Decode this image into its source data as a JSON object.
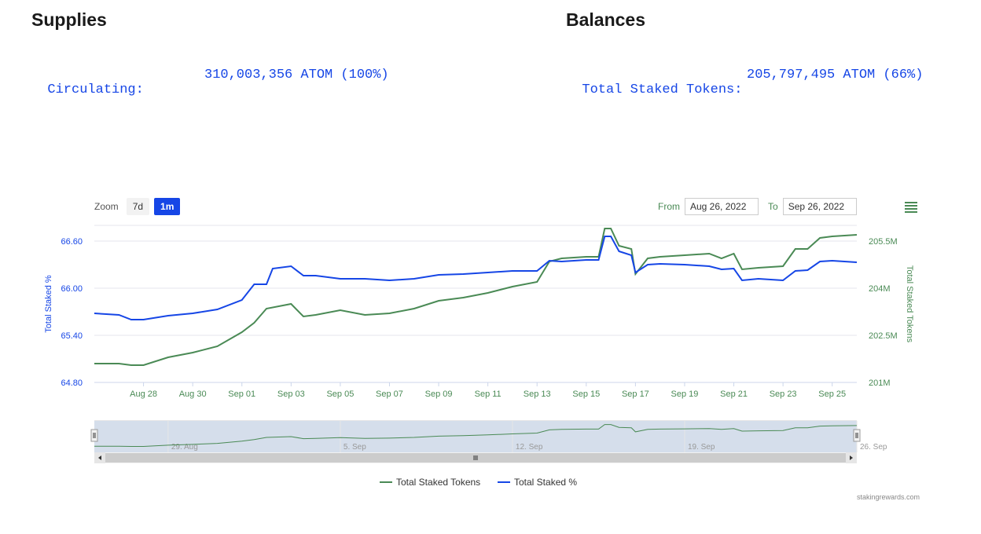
{
  "supplies": {
    "title": "Supplies",
    "label": "Circulating:",
    "value": "310,003,356 ATOM (100%)"
  },
  "balances": {
    "title": "Balances",
    "label": "Total Staked Tokens:",
    "value": "205,797,495 ATOM (66%)"
  },
  "toolbar": {
    "zoom_label": "Zoom",
    "zoom_buttons": [
      "7d",
      "1m"
    ],
    "zoom_active": "1m",
    "from_label": "From",
    "from_value": "Aug 26, 2022",
    "to_label": "To",
    "to_value": "Sep 26, 2022",
    "menu_icon": "hamburger-menu-icon"
  },
  "credit": "stakingrewards.com",
  "colors": {
    "tokens": "#4a8a55",
    "percent": "#1646e6",
    "navigator_fill": "#d5deeb",
    "grid": "#e4e4ee"
  },
  "chart_data": {
    "type": "line",
    "x_range": [
      "2022-08-26",
      "2022-09-26"
    ],
    "x_ticks": [
      "Aug 28",
      "Aug 30",
      "Sep 01",
      "Sep 03",
      "Sep 05",
      "Sep 07",
      "Sep 09",
      "Sep 11",
      "Sep 13",
      "Sep 15",
      "Sep 17",
      "Sep 19",
      "Sep 21",
      "Sep 23",
      "Sep 25"
    ],
    "x_tick_dates": [
      "2022-08-28",
      "2022-08-30",
      "2022-09-01",
      "2022-09-03",
      "2022-09-05",
      "2022-09-07",
      "2022-09-09",
      "2022-09-11",
      "2022-09-13",
      "2022-09-15",
      "2022-09-17",
      "2022-09-19",
      "2022-09-21",
      "2022-09-23",
      "2022-09-25"
    ],
    "y_left": {
      "label": "Total Staked %",
      "ticks": [
        "64.80",
        "65.40",
        "66.00",
        "66.60"
      ],
      "range": [
        64.8,
        66.8
      ]
    },
    "y_right": {
      "label": "Total Staked Tokens",
      "ticks": [
        "201M",
        "202.5M",
        "204M",
        "205.5M"
      ],
      "range": [
        201,
        206
      ]
    },
    "grid": true,
    "legend_position": "bottom-center",
    "series": [
      {
        "name": "Total Staked Tokens",
        "axis": "right",
        "unit": "M ATOM",
        "points": [
          [
            "2022-08-26",
            201.6
          ],
          [
            "2022-08-27",
            201.6
          ],
          [
            "2022-08-27T12:00",
            201.55
          ],
          [
            "2022-08-28",
            201.55
          ],
          [
            "2022-08-29",
            201.8
          ],
          [
            "2022-08-30",
            201.95
          ],
          [
            "2022-08-31",
            202.15
          ],
          [
            "2022-09-01",
            202.6
          ],
          [
            "2022-09-01T12:00",
            202.9
          ],
          [
            "2022-09-02",
            203.35
          ],
          [
            "2022-09-03",
            203.5
          ],
          [
            "2022-09-03T12:00",
            203.1
          ],
          [
            "2022-09-04",
            203.15
          ],
          [
            "2022-09-05",
            203.3
          ],
          [
            "2022-09-06",
            203.15
          ],
          [
            "2022-09-07",
            203.2
          ],
          [
            "2022-09-08",
            203.35
          ],
          [
            "2022-09-09",
            203.6
          ],
          [
            "2022-09-10",
            203.7
          ],
          [
            "2022-09-11",
            203.85
          ],
          [
            "2022-09-12",
            204.05
          ],
          [
            "2022-09-13",
            204.2
          ],
          [
            "2022-09-13T12:00",
            204.85
          ],
          [
            "2022-09-14",
            204.95
          ],
          [
            "2022-09-15",
            205.0
          ],
          [
            "2022-09-15T12:00",
            205.0
          ],
          [
            "2022-09-15T18:00",
            205.9
          ],
          [
            "2022-09-16",
            205.9
          ],
          [
            "2022-09-16T08:00",
            205.35
          ],
          [
            "2022-09-16T20:00",
            205.25
          ],
          [
            "2022-09-17",
            204.45
          ],
          [
            "2022-09-17T12:00",
            204.95
          ],
          [
            "2022-09-18",
            205.0
          ],
          [
            "2022-09-19",
            205.05
          ],
          [
            "2022-09-20",
            205.1
          ],
          [
            "2022-09-20T12:00",
            204.95
          ],
          [
            "2022-09-21",
            205.1
          ],
          [
            "2022-09-21T08:00",
            204.6
          ],
          [
            "2022-09-22",
            204.65
          ],
          [
            "2022-09-23",
            204.7
          ],
          [
            "2022-09-23T12:00",
            205.25
          ],
          [
            "2022-09-24",
            205.25
          ],
          [
            "2022-09-24T12:00",
            205.6
          ],
          [
            "2022-09-25",
            205.65
          ],
          [
            "2022-09-26",
            205.7
          ]
        ]
      },
      {
        "name": "Total Staked %",
        "axis": "left",
        "unit": "%",
        "points": [
          [
            "2022-08-26",
            65.68
          ],
          [
            "2022-08-27",
            65.66
          ],
          [
            "2022-08-27T12:00",
            65.6
          ],
          [
            "2022-08-28",
            65.6
          ],
          [
            "2022-08-29",
            65.65
          ],
          [
            "2022-08-30",
            65.68
          ],
          [
            "2022-08-31",
            65.73
          ],
          [
            "2022-09-01",
            65.85
          ],
          [
            "2022-09-01T12:00",
            66.05
          ],
          [
            "2022-09-02",
            66.05
          ],
          [
            "2022-09-02T06:00",
            66.25
          ],
          [
            "2022-09-03",
            66.28
          ],
          [
            "2022-09-03T12:00",
            66.16
          ],
          [
            "2022-09-04",
            66.16
          ],
          [
            "2022-09-05",
            66.12
          ],
          [
            "2022-09-06",
            66.12
          ],
          [
            "2022-09-07",
            66.1
          ],
          [
            "2022-09-08",
            66.12
          ],
          [
            "2022-09-09",
            66.17
          ],
          [
            "2022-09-10",
            66.18
          ],
          [
            "2022-09-11",
            66.2
          ],
          [
            "2022-09-12",
            66.22
          ],
          [
            "2022-09-13",
            66.22
          ],
          [
            "2022-09-13T12:00",
            66.35
          ],
          [
            "2022-09-14",
            66.34
          ],
          [
            "2022-09-15",
            66.36
          ],
          [
            "2022-09-15T12:00",
            66.36
          ],
          [
            "2022-09-15T18:00",
            66.66
          ],
          [
            "2022-09-16",
            66.66
          ],
          [
            "2022-09-16T08:00",
            66.47
          ],
          [
            "2022-09-16T20:00",
            66.42
          ],
          [
            "2022-09-17",
            66.2
          ],
          [
            "2022-09-17T12:00",
            66.3
          ],
          [
            "2022-09-18",
            66.31
          ],
          [
            "2022-09-19",
            66.3
          ],
          [
            "2022-09-20",
            66.28
          ],
          [
            "2022-09-20T12:00",
            66.24
          ],
          [
            "2022-09-21",
            66.25
          ],
          [
            "2022-09-21T08:00",
            66.1
          ],
          [
            "2022-09-22",
            66.12
          ],
          [
            "2022-09-23",
            66.1
          ],
          [
            "2022-09-23T12:00",
            66.22
          ],
          [
            "2022-09-24",
            66.23
          ],
          [
            "2022-09-24T12:00",
            66.34
          ],
          [
            "2022-09-25",
            66.35
          ],
          [
            "2022-09-26",
            66.33
          ]
        ]
      }
    ],
    "navigator": {
      "ticks": [
        "29. Aug",
        "5. Sep",
        "12. Sep",
        "19. Sep",
        "26. Sep"
      ],
      "tick_dates": [
        "2022-08-29",
        "2022-09-05",
        "2022-09-12",
        "2022-09-19",
        "2022-09-26"
      ],
      "selected_range": [
        "2022-08-26",
        "2022-09-26"
      ],
      "scrollbar_icon": "grip-lines-icon"
    }
  }
}
